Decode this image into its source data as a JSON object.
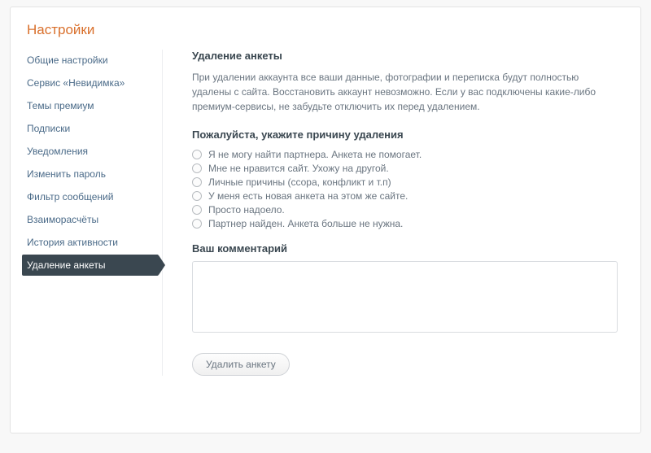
{
  "page_title": "Настройки",
  "sidebar": {
    "items": [
      {
        "label": "Общие настройки",
        "active": false
      },
      {
        "label": "Сервис «Невидимка»",
        "active": false
      },
      {
        "label": "Темы премиум",
        "active": false
      },
      {
        "label": "Подписки",
        "active": false
      },
      {
        "label": "Уведомления",
        "active": false
      },
      {
        "label": "Изменить пароль",
        "active": false
      },
      {
        "label": "Фильтр сообщений",
        "active": false
      },
      {
        "label": "Взаиморасчёты",
        "active": false
      },
      {
        "label": "История активности",
        "active": false
      },
      {
        "label": "Удаление анкеты",
        "active": true
      }
    ]
  },
  "main": {
    "heading": "Удаление анкеты",
    "description": "При удалении аккаунта все ваши данные, фотографии и переписка будут полностью удалены с сайта. Восстановить аккаунт невозможно. Если у вас подключены какие-либо премиум-сервисы, не забудьте отключить их перед удалением.",
    "reason_heading": "Пожалуйста, укажите причину удаления",
    "reasons": [
      "Я не могу найти партнера. Анкета не помогает.",
      "Мне не нравится сайт. Ухожу на другой.",
      "Личные причины (ссора, конфликт и т.п)",
      "У меня есть новая анкета на этом же сайте.",
      "Просто надоело.",
      "Партнер найден. Анкета больше не нужна."
    ],
    "comment_label": "Ваш комментарий",
    "comment_value": "",
    "delete_button": "Удалить анкету"
  }
}
